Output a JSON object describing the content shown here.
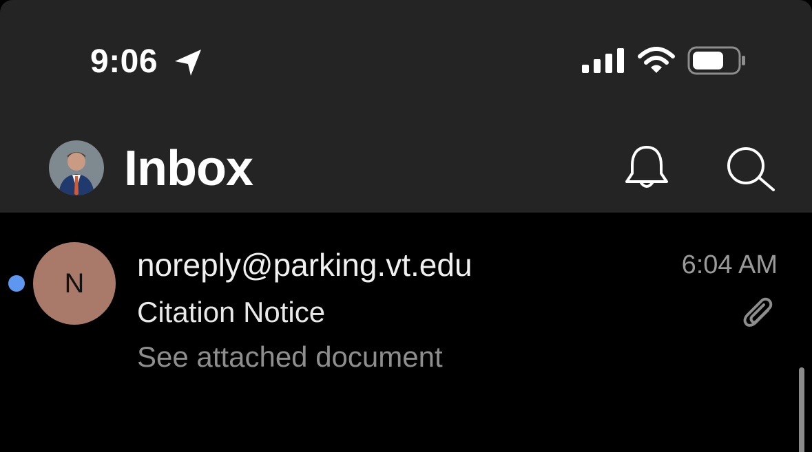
{
  "status_bar": {
    "time": "9:06",
    "icons": [
      "location-arrow-icon",
      "cellular-signal-icon",
      "wifi-icon",
      "battery-icon"
    ]
  },
  "header": {
    "title": "Inbox",
    "account_avatar": "profile-photo",
    "actions": [
      "bell-icon",
      "search-icon"
    ]
  },
  "messages": [
    {
      "unread": true,
      "avatar_letter": "N",
      "avatar_color": "#a97a6a",
      "sender": "noreply@parking.vt.edu",
      "time": "6:04 AM",
      "subject": "Citation Notice",
      "preview": "See attached document",
      "has_attachment": true
    }
  ],
  "colors": {
    "header_bg": "#242424",
    "list_bg": "#000000",
    "unread_dot": "#5e97f0",
    "primary_text": "#f0f0f0",
    "secondary_text": "#8e8e8e"
  }
}
